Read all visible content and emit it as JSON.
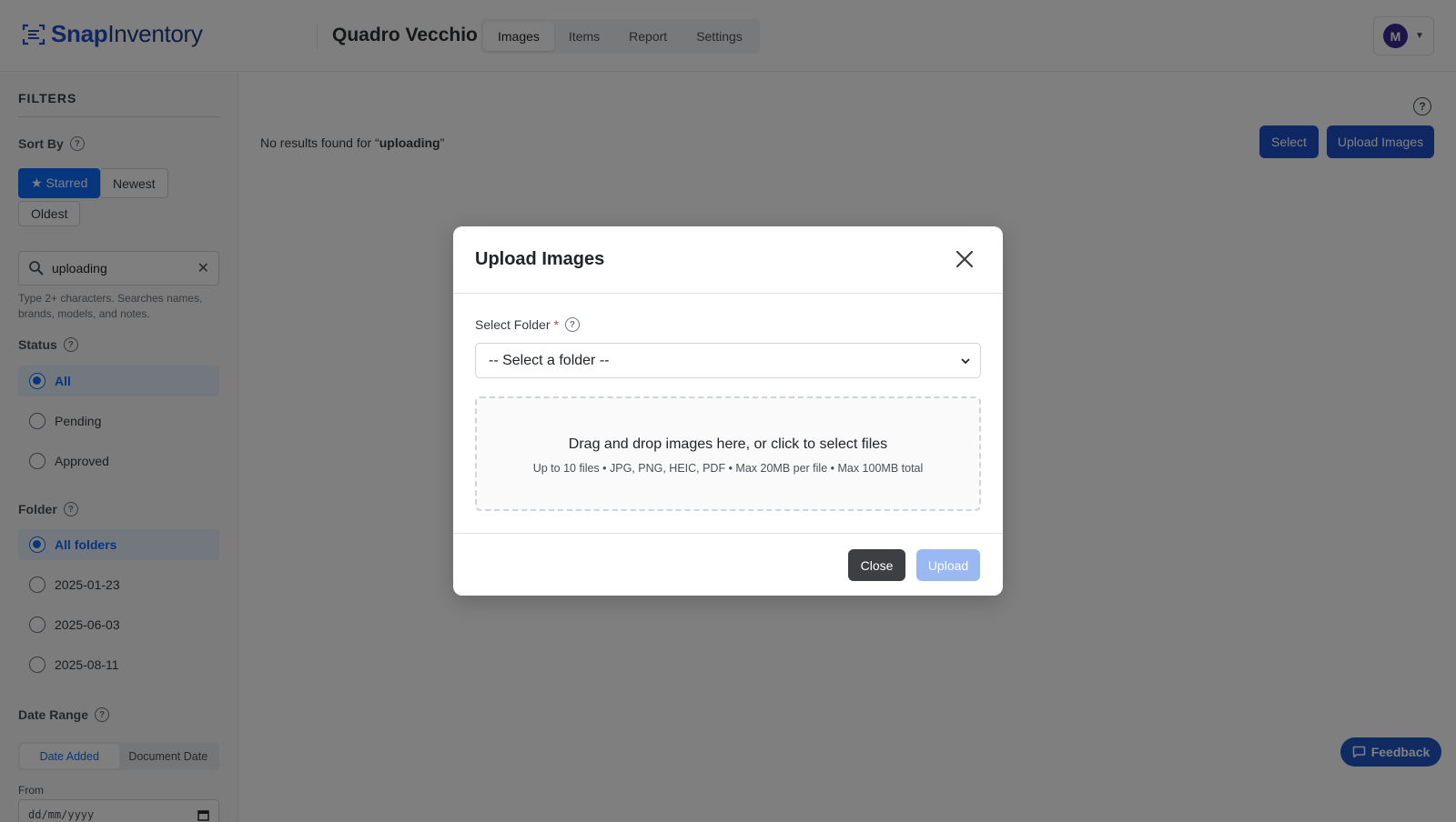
{
  "app": {
    "logo_snap": "Snap",
    "logo_inventory": "Inventory",
    "project_name": "Quadro Vecchio",
    "user_initial": "M"
  },
  "nav": {
    "tabs": [
      {
        "label": "Images",
        "active": true
      },
      {
        "label": "Items",
        "active": false
      },
      {
        "label": "Report",
        "active": false
      },
      {
        "label": "Settings",
        "active": false
      }
    ]
  },
  "sidebar": {
    "title": "FILTERS",
    "sort": {
      "label": "Sort By",
      "options": [
        {
          "label": "★ Starred",
          "active": true
        },
        {
          "label": "Newest",
          "active": false
        },
        {
          "label": "Oldest",
          "active": false
        }
      ]
    },
    "search": {
      "value": "uploading",
      "hint": "Type 2+ characters. Searches names, brands, models, and notes."
    },
    "status": {
      "label": "Status",
      "options": [
        {
          "label": "All",
          "selected": true
        },
        {
          "label": "Pending",
          "selected": false
        },
        {
          "label": "Approved",
          "selected": false
        }
      ]
    },
    "folder": {
      "label": "Folder",
      "options": [
        {
          "label": "All folders",
          "selected": true
        },
        {
          "label": "2025-01-23",
          "selected": false
        },
        {
          "label": "2025-06-03",
          "selected": false
        },
        {
          "label": "2025-08-11",
          "selected": false
        }
      ]
    },
    "date_range": {
      "label": "Date Range",
      "modes": [
        "Date Added",
        "Document Date"
      ],
      "active_mode": "Date Added",
      "from_label": "From",
      "from_placeholder": "dd/mm/yyyy"
    }
  },
  "main": {
    "no_results_prefix": "No results found for “",
    "no_results_query": "uploading",
    "no_results_suffix": "”",
    "select_button": "Select",
    "upload_button": "Upload Images",
    "feedback_button": "Feedback"
  },
  "modal": {
    "title": "Upload Images",
    "folder_label": "Select Folder",
    "required_mark": "*",
    "folder_select_value": "-- Select a folder --",
    "dropzone_text": "Drag and drop images here, or click to select files",
    "dropzone_subtext": "Up to 10 files • JPG, PNG, HEIC, PDF • Max 20MB per file • Max 100MB total",
    "close_button": "Close",
    "upload_button": "Upload"
  },
  "colors": {
    "brand": "#1f4fc6",
    "accent": "#0d6efd",
    "upload_disabled": "#9ab8f4",
    "close_button": "#3d3f42"
  }
}
